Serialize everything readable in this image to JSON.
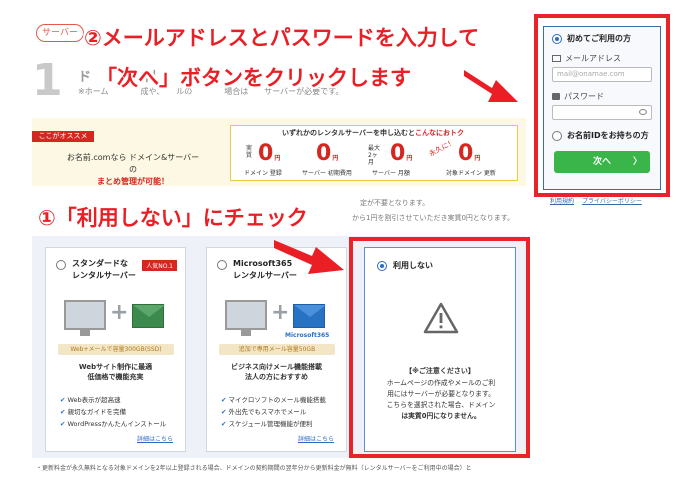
{
  "header": {
    "server_tag": "サーバー",
    "step_number": "1",
    "faint_title": "ド　　　　利",
    "faint_note": "※ホーム　　　　成や、　　ルの　　　　場合は　　サーバーが必要です。"
  },
  "instructions": {
    "top": "②メールアドレスとパスワードを入力して",
    "middle": "「次へ」ボタンをクリックします",
    "bottom": "①「利用しない」にチェック"
  },
  "login": {
    "option_first_time": "初めてご利用の方",
    "email_label": "メールアドレス",
    "email_placeholder": "mail@onamae.com",
    "password_label": "パスワード",
    "option_has_id": "お名前IDをお持ちの方",
    "next_button": "次へ",
    "next_chevron": "〉",
    "link_terms": "利用規約",
    "link_privacy": "プライバシーポリシー"
  },
  "promo": {
    "recommend_tag": "ここがオススメ",
    "left_line1": "お名前.comなら ドメイン&サーバー の",
    "left_line2": "まとめ管理が可能！",
    "heading_prefix": "いずれかのレンタルサーバーを申し込むと",
    "heading_emphasis": "こんなにおトク",
    "prices": [
      {
        "pre": "実質",
        "value": "0",
        "unit": "円",
        "label": "ドメイン 登録"
      },
      {
        "pre": "",
        "value": "0",
        "unit": "円",
        "label": "サーバー 初期費用"
      },
      {
        "pre": "最大2ヶ月",
        "value": "0",
        "unit": "円",
        "label": "サーバー 月額"
      },
      {
        "pre": "",
        "value": "0",
        "unit": "円",
        "label": "対象ドメイン 更新"
      }
    ],
    "forever": "永久に！"
  },
  "notes": {
    "mid1": "定が不要となります。",
    "mid2": "から1円を割引させていただき実質0円となります。"
  },
  "plans": [
    {
      "title_line1": "スタンダードな",
      "title_line2": "レンタルサーバー",
      "badge": "人気NO.1",
      "pill": "Web+メールで容量300GB(SSD)",
      "desc_line1": "Webサイト制作に最適",
      "desc_line2": "低価格で機能充実",
      "features": [
        "Web表示が超高速",
        "親切なガイドを完備",
        "WordPressかんたんインストール"
      ],
      "link": "詳細はこちら"
    },
    {
      "title_line1": "Microsoft365",
      "title_line2": "レンタルサーバー",
      "badge": "",
      "ms_label": "Microsoft365",
      "pill": "追加で専用メール容量50GB",
      "desc_line1": "ビジネス向けメール機能搭載",
      "desc_line2": "法人の方におすすめ",
      "features": [
        "マイクロソフトのメール機能搭載",
        "外出先でもスマホでメール",
        "スケジュール管理機能が便利"
      ],
      "link": "詳細はこちら"
    }
  ],
  "no_use": {
    "label": "利用しない",
    "caution": "【※ご注意ください】",
    "body_line1": "ホームページの作成やメールのご利",
    "body_line2": "用にはサーバーが必要となります。",
    "body_line3": "こちらを選択された場合、ドメイン",
    "body_line4": "は実質0円になりません。"
  },
  "footnote": "・更新料金が永久無料となる対象ドメインを2年以上登録される場合、ドメインの契約期間の翌年分から更新料金が無料（レンタルサーバーをご利用中の場合）と",
  "colors": {
    "instruction_red": "#ea1f25",
    "highlight_red": "#e8232a",
    "next_green": "#39b54a",
    "accent_blue": "#2b6cc4",
    "promo_bg": "#fdf8e3"
  }
}
